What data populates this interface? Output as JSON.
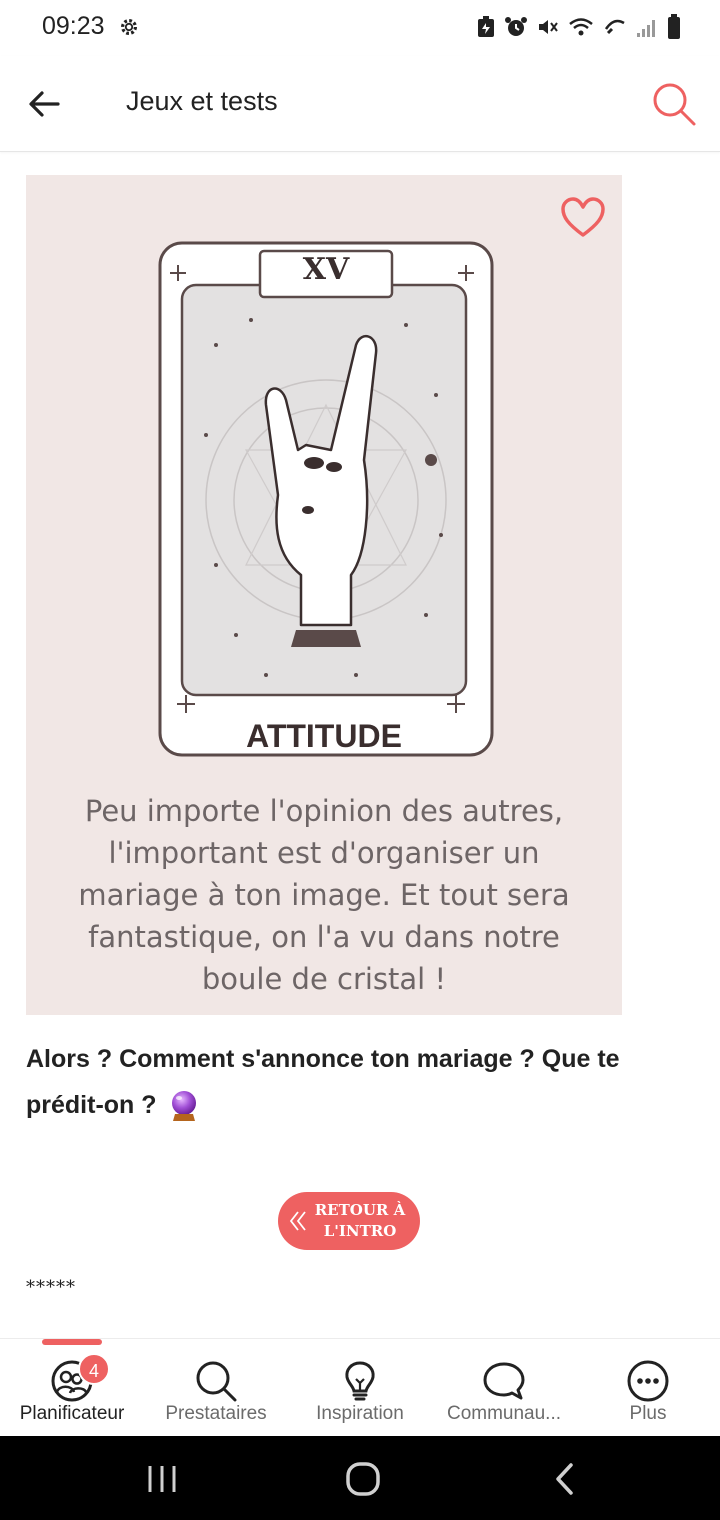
{
  "status_bar": {
    "time": "09:23"
  },
  "header": {
    "title": "Jeux et tests"
  },
  "content": {
    "card_numeral": "XV",
    "card_title": "ATTITUDE",
    "caption_lines": [
      "Peu importe l'opinion des autres,",
      "l'important est d'organiser un",
      "mariage à ton image. Et tout sera",
      "fantastique, on l'a vu dans notre",
      "boule de cristal !"
    ],
    "question": "Alors ? Comment s'annonce ton mariage ? Que te prédit-on ?",
    "back_button_line1": "RETOUR À",
    "back_button_line2": "L'INTRO",
    "stars": "*****"
  },
  "bottom_nav": {
    "items": [
      {
        "label": "Planificateur",
        "icon": "planner-icon",
        "active": true,
        "badge": "4"
      },
      {
        "label": "Prestataires",
        "icon": "search-icon"
      },
      {
        "label": "Inspiration",
        "icon": "lightbulb-icon"
      },
      {
        "label": "Communau...",
        "icon": "chat-bubble-icon"
      },
      {
        "label": "Plus",
        "icon": "more-icon"
      }
    ]
  },
  "colors": {
    "accent": "#ee6161",
    "card_background": "#f1e7e5",
    "caption_text": "#6d6566",
    "system_nav": "#000000"
  }
}
